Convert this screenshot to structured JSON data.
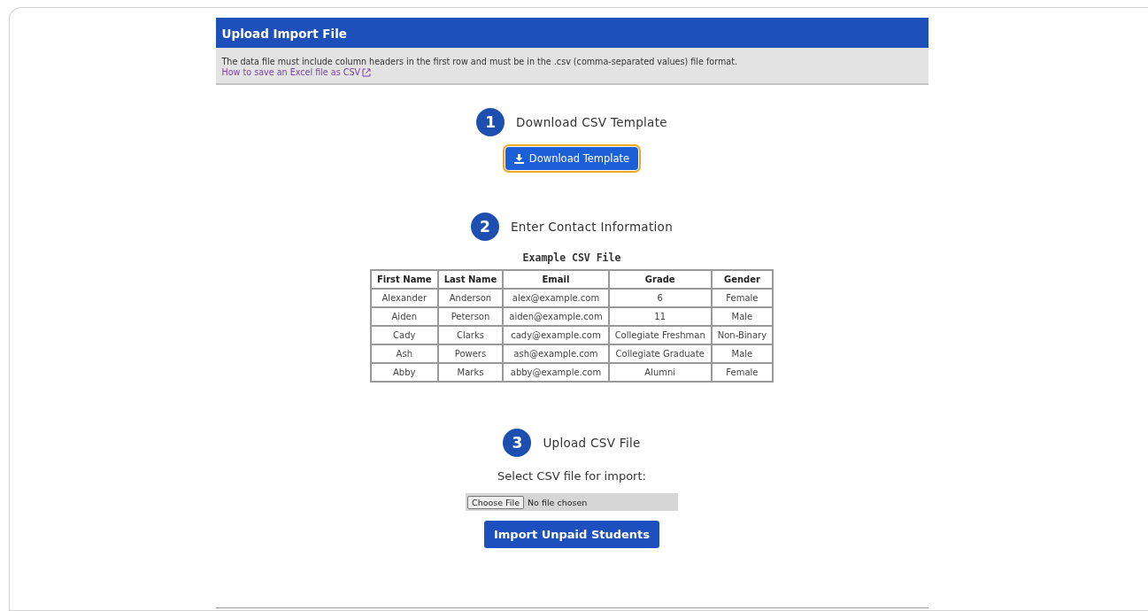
{
  "panel": {
    "title": "Upload Import File",
    "note": "The data file must include column headers in the first row and must be in the .csv (comma-separated values) file format.",
    "help_link": "How to save an Excel file as CSV"
  },
  "steps": [
    {
      "number": "1",
      "title": "Download CSV Template",
      "kind": "download"
    },
    {
      "number": "2",
      "title": "Enter Contact Information",
      "kind": "example"
    },
    {
      "number": "3",
      "title": "Upload CSV File",
      "kind": "upload"
    }
  ],
  "download_button": {
    "label": "Download Template",
    "focused": true
  },
  "example": {
    "caption": "Example CSV File",
    "columns": [
      "First Name",
      "Last Name",
      "Email",
      "Grade",
      "Gender"
    ],
    "rows": [
      [
        "Alexander",
        "Anderson",
        "alex@example.com",
        "6",
        "Female"
      ],
      [
        "Aiden",
        "Peterson",
        "aiden@example.com",
        "11",
        "Male"
      ],
      [
        "Cady",
        "Clarks",
        "cady@example.com",
        "Collegiate Freshman",
        "Non-Binary"
      ],
      [
        "Ash",
        "Powers",
        "ash@example.com",
        "Collegiate Graduate",
        "Male"
      ],
      [
        "Abby",
        "Marks",
        "abby@example.com",
        "Alumni",
        "Female"
      ]
    ]
  },
  "upload": {
    "prompt": "Select CSV file for import:",
    "choose_label": "Choose File",
    "file_status": "No file chosen",
    "submit_label": "Import Unpaid Students"
  }
}
